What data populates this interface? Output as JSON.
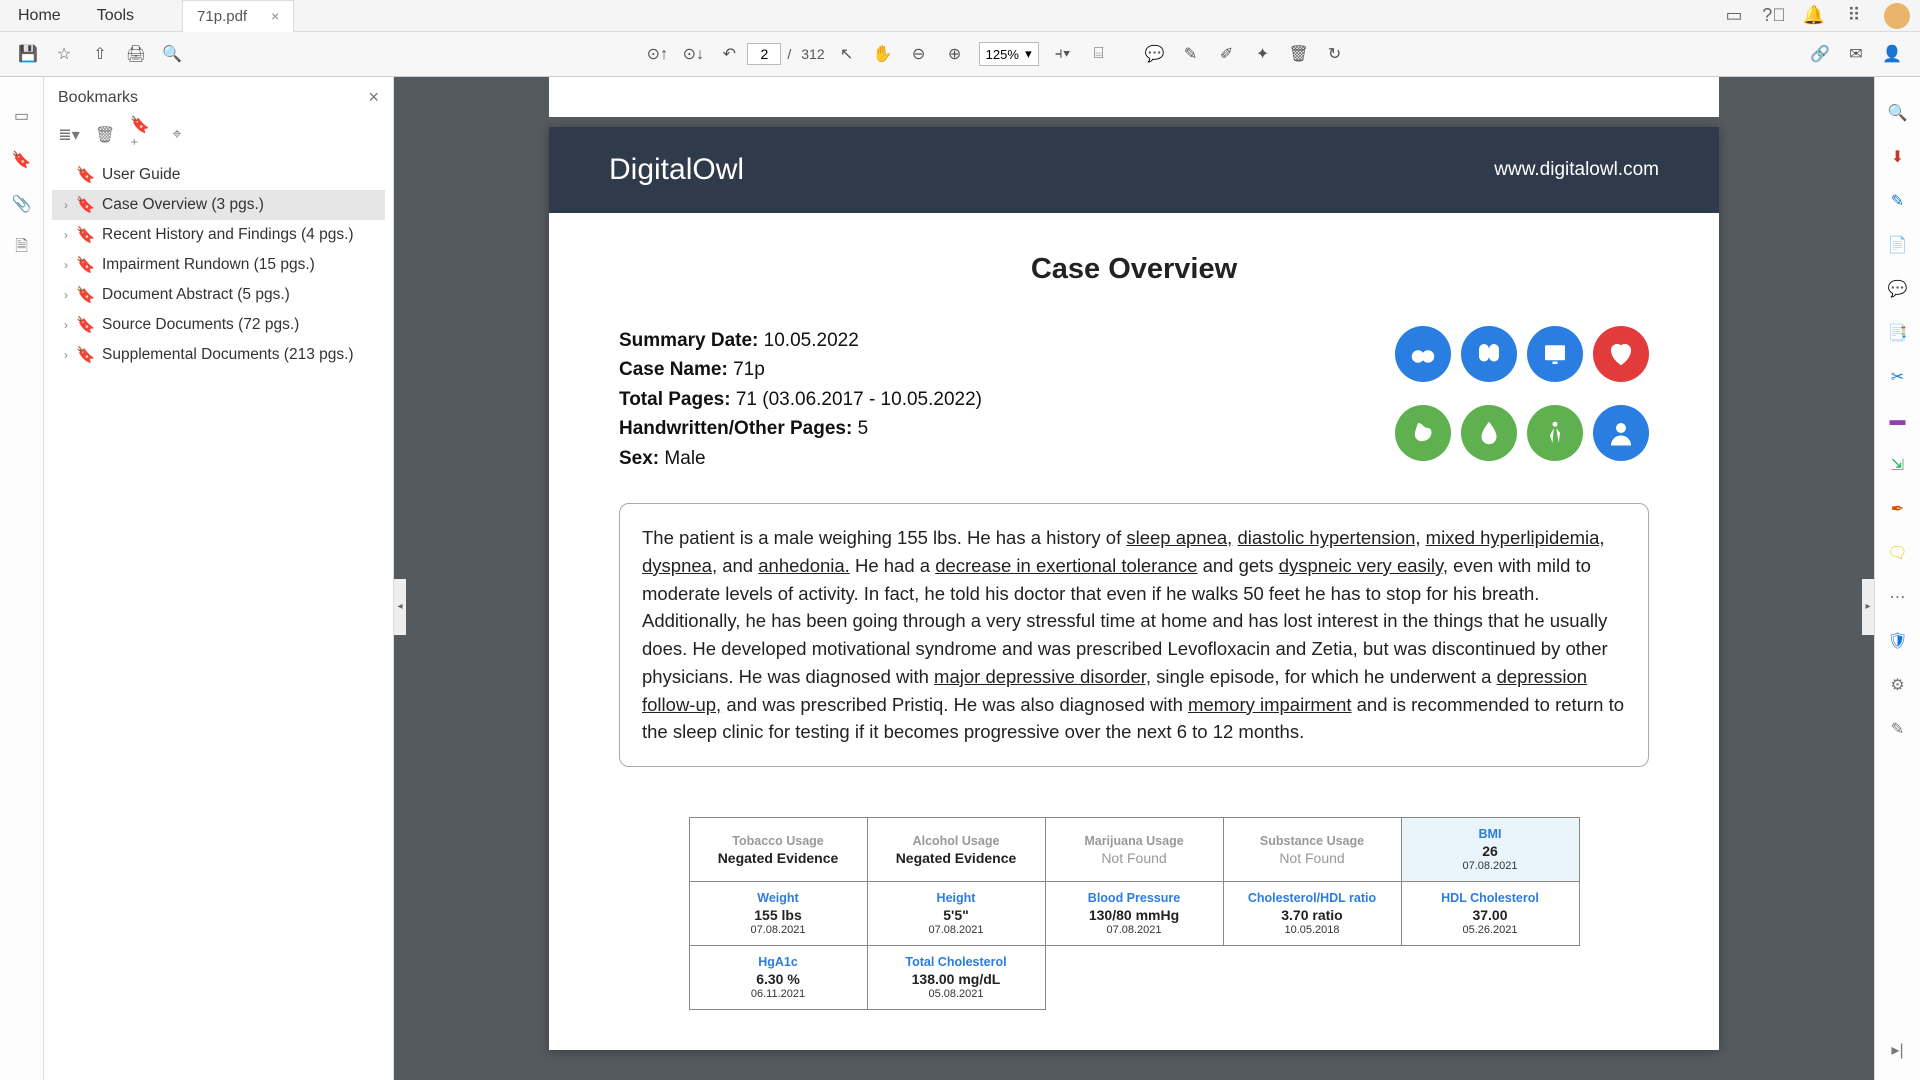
{
  "tabbar": {
    "home": "Home",
    "tools": "Tools",
    "doc_name": "71p.pdf",
    "close": "×"
  },
  "toolbar": {
    "page_current": "2",
    "page_sep": "/",
    "page_total": "312",
    "zoom": "125%"
  },
  "bookmarks": {
    "title": "Bookmarks",
    "items": [
      {
        "label": "User Guide",
        "expandable": false,
        "selected": false
      },
      {
        "label": "Case Overview (3 pgs.)",
        "expandable": true,
        "selected": true
      },
      {
        "label": "Recent History and Findings (4 pgs.)",
        "expandable": true,
        "selected": false
      },
      {
        "label": "Impairment Rundown (15 pgs.)",
        "expandable": true,
        "selected": false
      },
      {
        "label": "Document Abstract (5 pgs.)",
        "expandable": true,
        "selected": false
      },
      {
        "label": "Source Documents (72 pgs.)",
        "expandable": true,
        "selected": false
      },
      {
        "label": "Supplemental Documents (213 pgs.)",
        "expandable": true,
        "selected": false
      }
    ]
  },
  "doc": {
    "brand_a": "Digital",
    "brand_b": "Owl",
    "url": "www.digitalowl.com",
    "title": "Case Overview",
    "meta": {
      "summary_date_l": "Summary Date:",
      "summary_date_v": "10.05.2022",
      "case_name_l": "Case Name:",
      "case_name_v": "71p",
      "total_pages_l": "Total Pages:",
      "total_pages_v": "71 (03.06.2017 - 10.05.2022)",
      "handwritten_l": "Handwritten/Other Pages:",
      "handwritten_v": "5",
      "sex_l": "Sex:",
      "sex_v": "Male"
    },
    "summary_parts": {
      "p0": "The patient is a male weighing 155 lbs. He has a history of ",
      "u1": "sleep apnea,",
      "p1": " ",
      "u2": "diastolic hypertension,",
      "p2": " ",
      "u3": "mixed hyperlipidemia,",
      "p3": " ",
      "u4": "dyspnea,",
      "p4": " and ",
      "u5": "anhedonia.",
      "p5": " He had a ",
      "u6": "decrease in exertional tolerance",
      "p6": " and gets ",
      "u7": "dyspneic very easily,",
      "p7": " even with mild to moderate levels of activity. In fact, he told his doctor that even if he walks 50 feet he has to stop for his breath. Additionally, he has been going through a very stressful time at home and has lost interest in the things that he usually does. He developed motivational syndrome and was prescribed Levofloxacin and Zetia, but was discontinued by other physicians. He was diagnosed with ",
      "u8": "major depressive disorder,",
      "p8": " single episode, for which he underwent a ",
      "u9": "depression follow-up,",
      "p9": " and was prescribed Pristiq. He was also diagnosed with ",
      "u10": "memory impairment",
      "p10": " and is recommended to return to the sleep clinic for testing if it becomes progressive over the next 6 to 12 months."
    },
    "metrics": {
      "tob": {
        "l": "Tobacco Usage",
        "v": "Negated Evidence",
        "d": ""
      },
      "alc": {
        "l": "Alcohol Usage",
        "v": "Negated Evidence",
        "d": ""
      },
      "mar": {
        "l": "Marijuana Usage",
        "v": "Not Found",
        "d": ""
      },
      "sub": {
        "l": "Substance Usage",
        "v": "Not Found",
        "d": ""
      },
      "bmi": {
        "l": "BMI",
        "v": "26",
        "d": "07.08.2021"
      },
      "wt": {
        "l": "Weight",
        "v": "155 lbs",
        "d": "07.08.2021"
      },
      "ht": {
        "l": "Height",
        "v": "5'5\"",
        "d": "07.08.2021"
      },
      "bp": {
        "l": "Blood Pressure",
        "v": "130/80 mmHg",
        "d": "07.08.2021"
      },
      "chol": {
        "l": "Cholesterol/HDL ratio",
        "v": "3.70 ratio",
        "d": "10.05.2018"
      },
      "hdl": {
        "l": "HDL Cholesterol",
        "v": "37.00",
        "d": "05.26.2021"
      },
      "a1c": {
        "l": "HgA1c",
        "v": "6.30 %",
        "d": "06.11.2021"
      },
      "tchol": {
        "l": "Total Cholesterol",
        "v": "138.00 mg/dL",
        "d": "05.08.2021"
      }
    }
  }
}
